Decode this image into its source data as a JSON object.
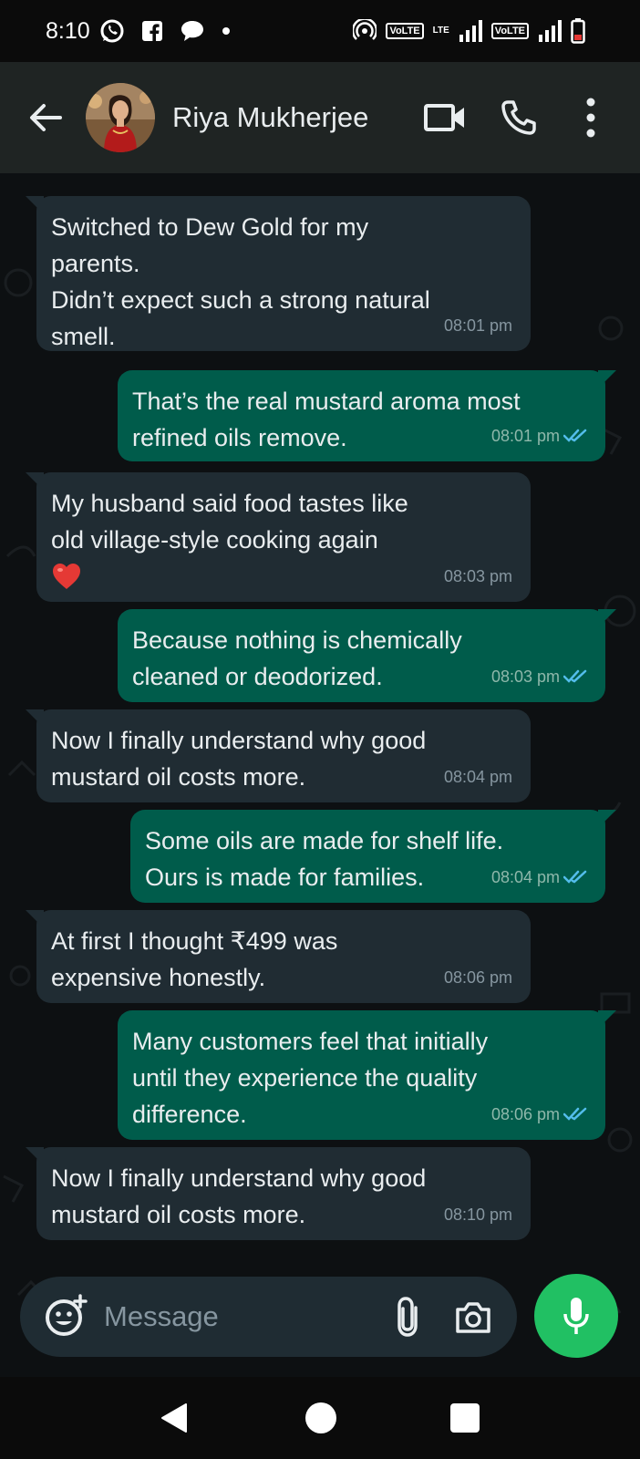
{
  "status_bar": {
    "time": "8:10",
    "volte1": "VoLTE",
    "lte": "LTE",
    "volte2": "VoLTE"
  },
  "header": {
    "contact_name": "Riya Mukherjee"
  },
  "messages": [
    {
      "direction": "in",
      "text": "Switched to Dew Gold for my\nparents.\nDidn’t expect such a strong natural\nsmell.",
      "time": "08:01 pm"
    },
    {
      "direction": "out",
      "text": "That’s the real mustard aroma most\nrefined oils remove.",
      "time": "08:01 pm",
      "status": "read"
    },
    {
      "direction": "in",
      "text": "My husband said food tastes like\nold village-style cooking again",
      "emoji": "heart",
      "time": "08:03 pm"
    },
    {
      "direction": "out",
      "text": "Because nothing is chemically\ncleaned or deodorized.",
      "time": "08:03 pm",
      "status": "read"
    },
    {
      "direction": "in",
      "text": "Now I finally understand why good\nmustard oil costs more.",
      "time": "08:04 pm"
    },
    {
      "direction": "out",
      "text": "Some oils are made for shelf life.\nOurs is made for families.",
      "time": "08:04 pm",
      "status": "read"
    },
    {
      "direction": "in",
      "text": "At first I thought ₹499 was\nexpensive honestly.",
      "time": "08:06 pm"
    },
    {
      "direction": "out",
      "text": "Many customers feel that initially\nuntil they experience the quality\ndifference.",
      "time": "08:06 pm",
      "status": "read"
    },
    {
      "direction": "in",
      "text": "Now I finally understand why good\nmustard oil costs more.",
      "time": "08:10 pm"
    }
  ],
  "input": {
    "placeholder": "Message"
  },
  "colors": {
    "incoming_bubble": "#202c33",
    "outgoing_bubble": "#005c4b",
    "header": "#1f2423",
    "mic_button": "#21c063",
    "read_ticks": "#53bdeb"
  }
}
